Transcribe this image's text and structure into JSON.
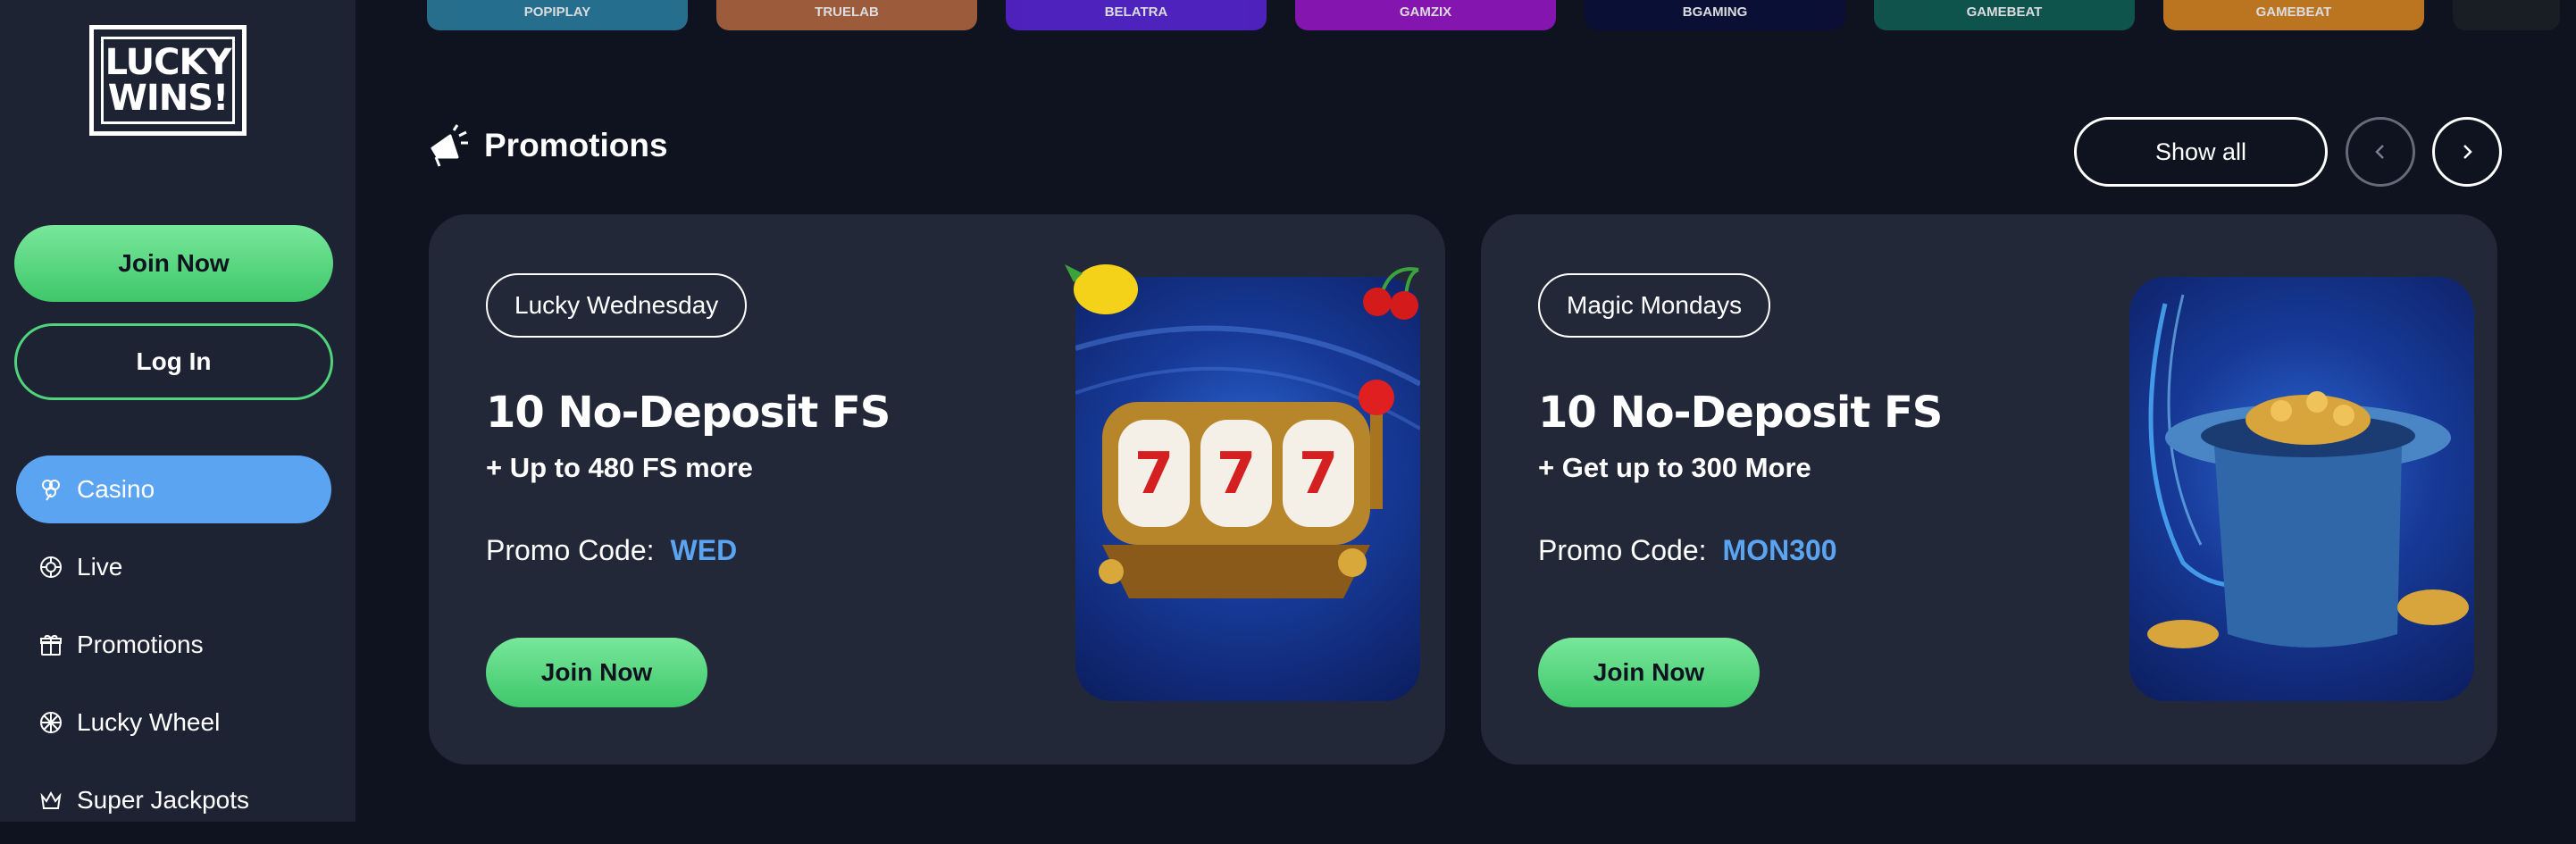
{
  "sidebar": {
    "logo_line1": "LUCKY",
    "logo_line2": "WINS!",
    "join_label": "Join Now",
    "login_label": "Log In",
    "nav": [
      {
        "label": "Casino",
        "icon": "clover-icon"
      },
      {
        "label": "Live",
        "icon": "chip-icon"
      },
      {
        "label": "Promotions",
        "icon": "gift-icon"
      },
      {
        "label": "Lucky Wheel",
        "icon": "wheel-icon"
      },
      {
        "label": "Super Jackpots",
        "icon": "crown-icon"
      }
    ]
  },
  "providers": [
    {
      "label": "POPIPLAY",
      "color": "#2a7fa0"
    },
    {
      "label": "TRUELAB",
      "color": "#b5683f"
    },
    {
      "label": "BELATRA",
      "color": "#5a25d8"
    },
    {
      "label": "GAMZIX",
      "color": "#9a16c9"
    },
    {
      "label": "BGAMING",
      "color": "#0a0f3a"
    },
    {
      "label": "GAMEBEAT",
      "color": "#0f5f55"
    },
    {
      "label": "GAMEBEAT",
      "color": "#d98722"
    },
    {
      "label": "",
      "color": "#1b2126"
    }
  ],
  "section": {
    "title": "Promotions",
    "icon": "megaphone-icon",
    "show_all": "Show all"
  },
  "promos": [
    {
      "tag": "Lucky Wednesday",
      "title": "10 No-Deposit FS",
      "subtitle": "+ Up to 480 FS more",
      "code_label": "Promo Code:",
      "code": "WED",
      "cta": "Join Now",
      "art": "slot-machine-777"
    },
    {
      "tag": "Magic Mondays",
      "title": "10 No-Deposit FS",
      "subtitle": "+ Get up to 300 More",
      "code_label": "Promo Code:",
      "code": "MON300",
      "cta": "Join Now",
      "art": "magic-hat-coins"
    }
  ],
  "colors": {
    "background": "#0f1320",
    "sidebar": "#1e2334",
    "card": "#232839",
    "accent_green": "#4fd47c",
    "accent_blue": "#5ba4f2"
  }
}
